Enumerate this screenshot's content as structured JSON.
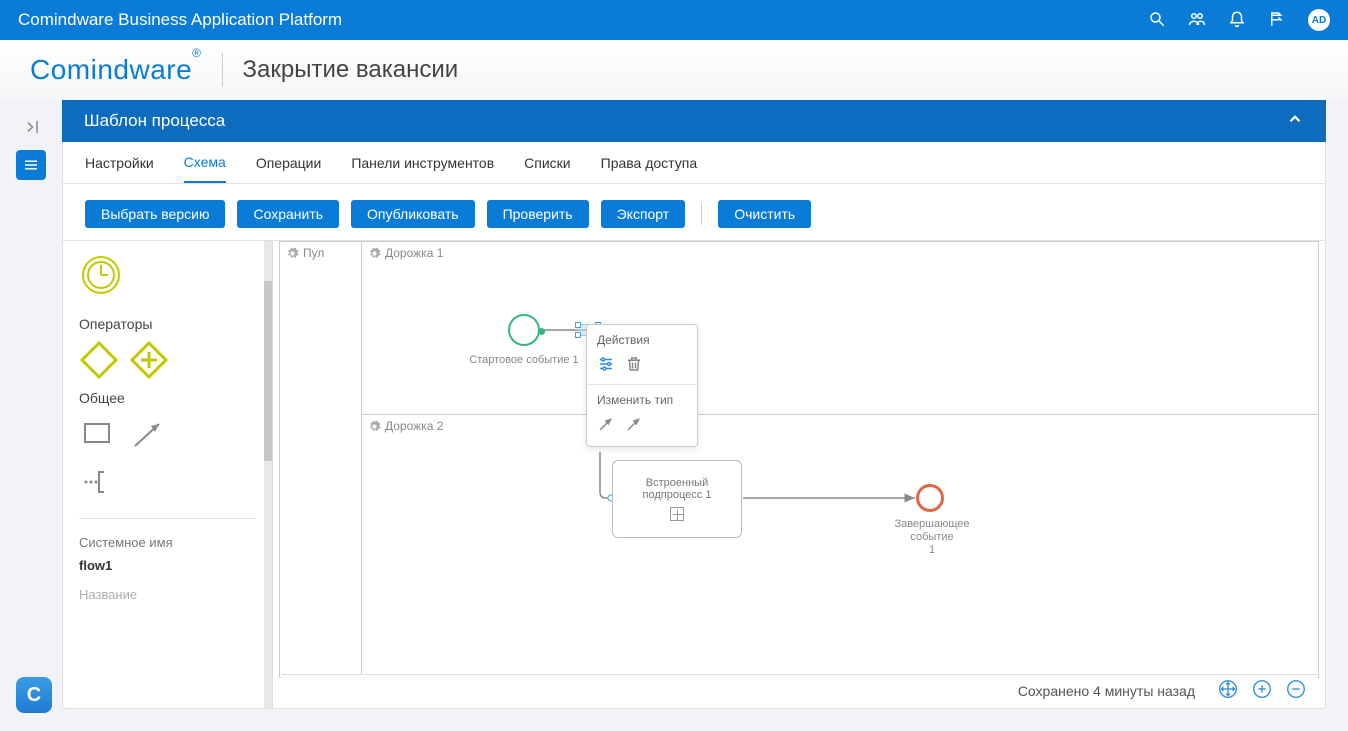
{
  "app": {
    "title": "Comindware Business Application Platform",
    "avatar": "AD"
  },
  "brand": {
    "name": "Comindware",
    "reg": "®",
    "page_title": "Закрытие вакансии"
  },
  "rail": {
    "logo_letter": "C"
  },
  "panel": {
    "title": "Шаблон процесса"
  },
  "tabs": [
    {
      "label": "Настройки",
      "active": false
    },
    {
      "label": "Схема",
      "active": true
    },
    {
      "label": "Операции",
      "active": false
    },
    {
      "label": "Панели инструментов",
      "active": false
    },
    {
      "label": "Списки",
      "active": false
    },
    {
      "label": "Права доступа",
      "active": false
    }
  ],
  "toolbar": {
    "select_version": "Выбрать версию",
    "save": "Сохранить",
    "publish": "Опубликовать",
    "check": "Проверить",
    "export": "Экспорт",
    "clear": "Очистить"
  },
  "sidebar": {
    "operators_label": "Операторы",
    "general_label": "Общее",
    "sysname_label": "Системное имя",
    "sysname_value": "flow1",
    "name_label": "Название"
  },
  "diagram": {
    "pool_label": "Пул",
    "lane1_label": "Дорожка 1",
    "lane2_label": "Дорожка 2",
    "start_event_label": "Стартовое событие 1",
    "subprocess_label_1": "Встроенный",
    "subprocess_label_2": "подпроцесс 1",
    "end_event_label_1": "Завершающее событие",
    "end_event_label_2": "1"
  },
  "context_menu": {
    "actions_label": "Действия",
    "change_type_label": "Изменить тип"
  },
  "status": {
    "saved_text": "Сохранено 4 минуты назад"
  }
}
